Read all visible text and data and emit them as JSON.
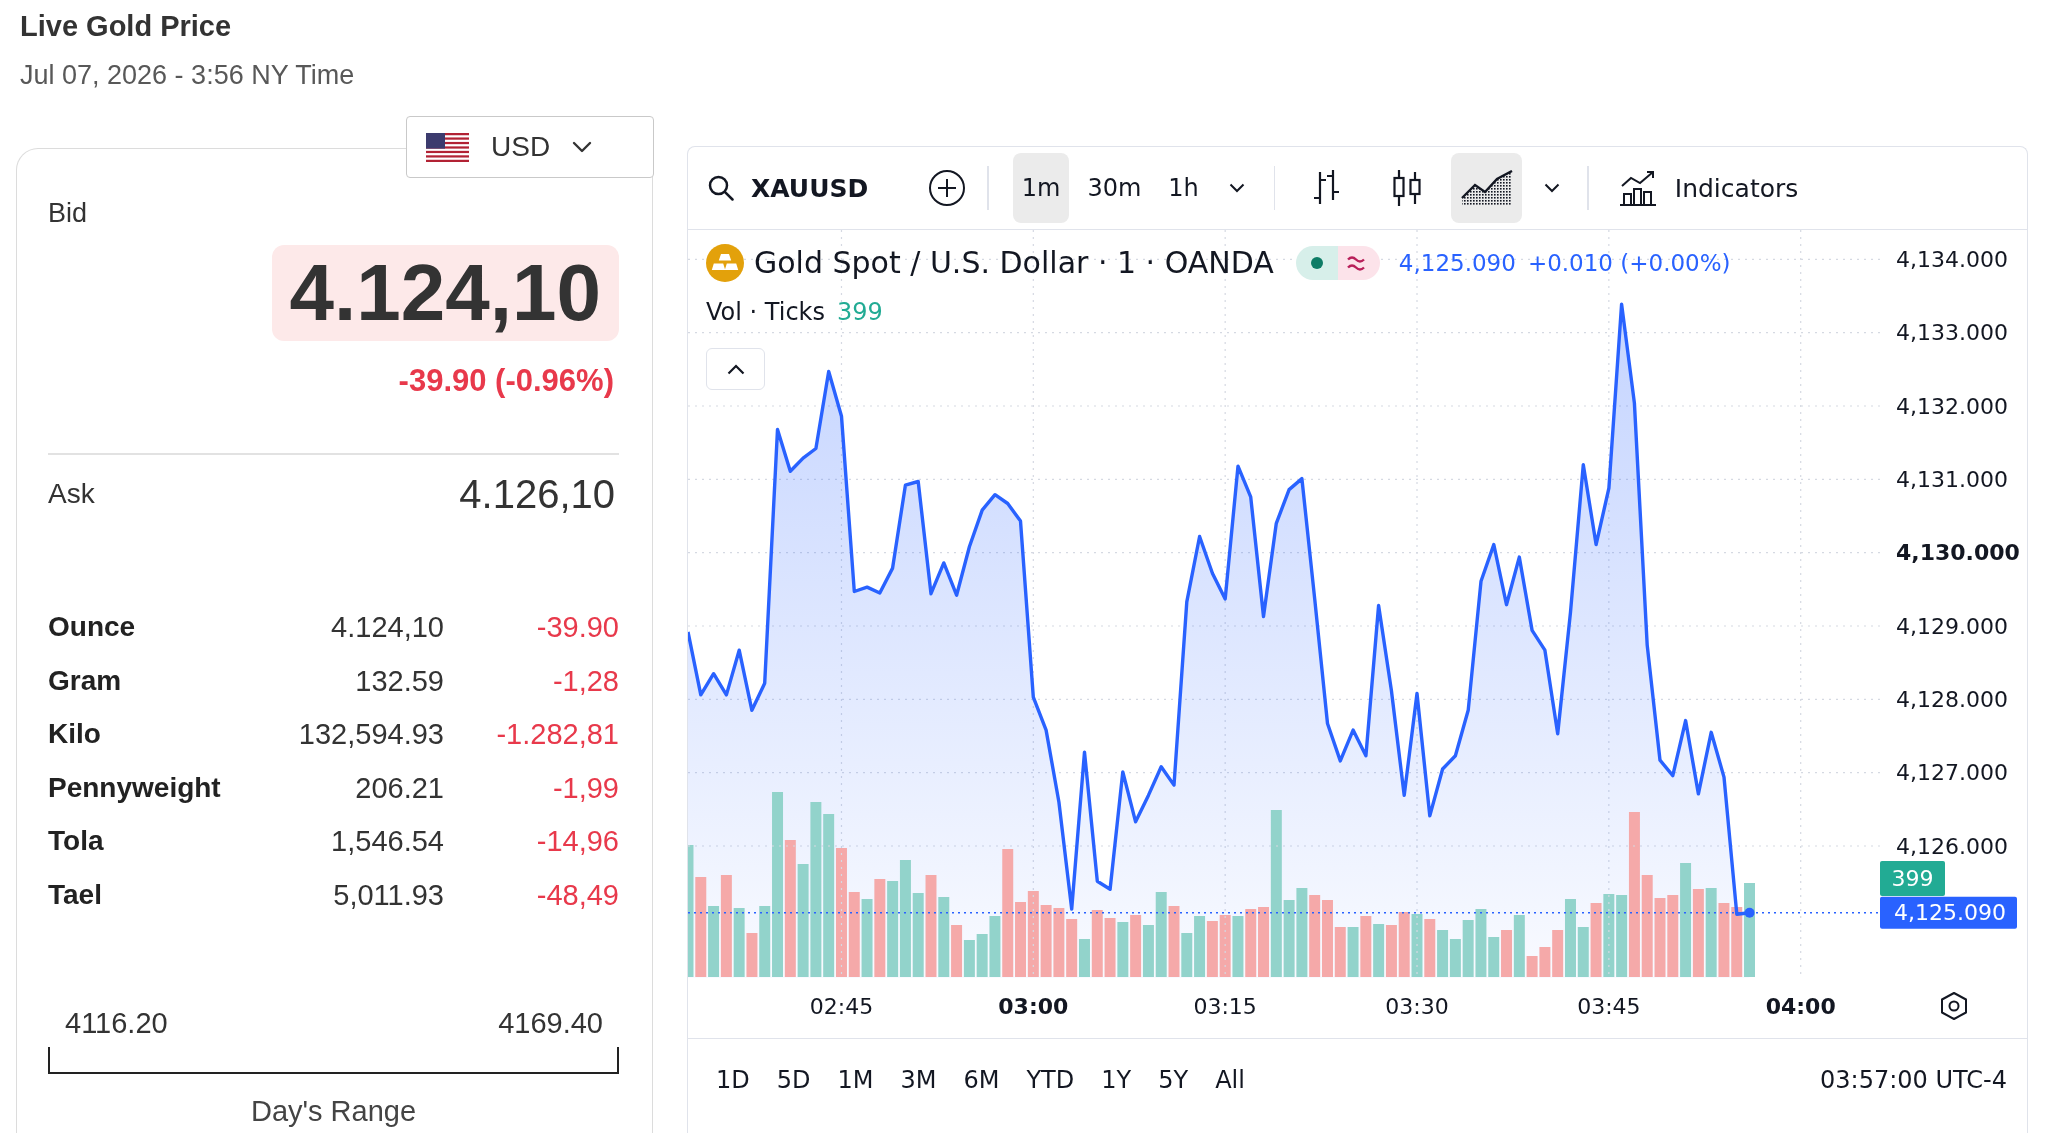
{
  "header": {
    "title": "Live Gold Price",
    "timestamp": "Jul 07, 2026 - 3:56 NY Time"
  },
  "currency": {
    "code": "USD"
  },
  "bid": {
    "label": "Bid",
    "value": "4.124,10",
    "change": "-39.90 (-0.96%)",
    "negative": true
  },
  "ask": {
    "label": "Ask",
    "value": "4.126,10"
  },
  "units": [
    {
      "unit": "Ounce",
      "price": "4.124,10",
      "change": "-39.90",
      "negative": true
    },
    {
      "unit": "Gram",
      "price": "132.59",
      "change": "-1,28",
      "negative": true
    },
    {
      "unit": "Kilo",
      "price": "132,594.93",
      "change": "-1.282,81",
      "negative": true
    },
    {
      "unit": "Pennyweight",
      "price": "206.21",
      "change": "-1,99",
      "negative": true
    },
    {
      "unit": "Tola",
      "price": "1,546.54",
      "change": "-14,96",
      "negative": true
    },
    {
      "unit": "Tael",
      "price": "5,011.93",
      "change": "-48,49",
      "negative": true
    }
  ],
  "days_range": {
    "low": "4116.20",
    "high": "4169.40",
    "label": "Day's Range"
  },
  "chart": {
    "toolbar": {
      "symbol": "XAUUSD",
      "intervals": [
        {
          "label": "1m",
          "selected": true
        },
        {
          "label": "30m",
          "selected": false
        },
        {
          "label": "1h",
          "selected": false
        }
      ],
      "chart_styles": [
        {
          "kind": "bars",
          "selected": false
        },
        {
          "kind": "candles",
          "selected": false
        },
        {
          "kind": "area",
          "selected": true
        }
      ],
      "indicators_label": "Indicators"
    },
    "legend": {
      "title": "Gold Spot / U.S. Dollar · 1 · OANDA",
      "last_price": "4,125.090",
      "change": "+0.010 (+0.00%)",
      "volume_label": "Vol · Ticks",
      "volume_value": "399"
    },
    "volume_tag": "399",
    "chart_data": {
      "type": "area",
      "grid": true,
      "xlim": [
        153,
        246.2
      ],
      "ylim": [
        4124.2,
        4134.4
      ],
      "x": [
        153,
        154,
        155,
        156,
        157,
        158,
        159,
        160,
        161,
        162,
        163,
        164,
        165,
        166,
        167,
        168,
        169,
        170,
        171,
        172,
        173,
        174,
        175,
        176,
        177,
        178,
        179,
        180,
        181,
        182,
        183,
        184,
        185,
        186,
        187,
        188,
        189,
        190,
        191,
        192,
        193,
        194,
        195,
        196,
        197,
        198,
        199,
        200,
        201,
        202,
        203,
        204,
        205,
        206,
        207,
        208,
        209,
        210,
        211,
        212,
        213,
        214,
        215,
        216,
        217,
        218,
        219,
        220,
        221,
        222,
        223,
        224,
        225,
        226,
        227,
        228,
        229,
        230,
        231,
        232,
        233,
        234,
        235,
        236
      ],
      "series": [
        {
          "color": "#2962ff",
          "values": [
            4128.92,
            4128.06,
            4128.35,
            4128.06,
            4128.67,
            4127.85,
            4128.22,
            4131.68,
            4131.11,
            4131.29,
            4131.42,
            4132.47,
            4131.86,
            4129.47,
            4129.53,
            4129.45,
            4129.79,
            4130.92,
            4130.97,
            4129.44,
            4129.86,
            4129.42,
            4130.08,
            4130.58,
            4130.79,
            4130.67,
            4130.43,
            4128.03,
            4127.58,
            4126.6,
            4125.14,
            4127.28,
            4125.52,
            4125.41,
            4127.01,
            4126.33,
            4126.69,
            4127.08,
            4126.83,
            4129.33,
            4130.22,
            4129.72,
            4129.37,
            4131.18,
            4130.76,
            4129.13,
            4130.4,
            4130.86,
            4131.01,
            4129.37,
            4127.67,
            4127.16,
            4127.58,
            4127.23,
            4129.28,
            4128.12,
            4126.69,
            4128.08,
            4126.41,
            4127.05,
            4127.23,
            4127.85,
            4129.61,
            4130.11,
            4129.29,
            4129.94,
            4128.94,
            4128.67,
            4127.53,
            4129.19,
            4131.2,
            4130.11,
            4130.88,
            4133.39,
            4132.04,
            4128.74,
            4127.17,
            4126.96,
            4127.71,
            4126.71,
            4127.55,
            4126.94,
            4125.07,
            4125.09
          ]
        }
      ],
      "ref_lines": [
        {
          "axis": "y",
          "value": 4125.09,
          "label": "4,125.090"
        }
      ],
      "xticks": [
        {
          "value": 165,
          "label": "02:45"
        },
        {
          "value": 180,
          "label": "03:00"
        },
        {
          "value": 195,
          "label": "03:15"
        },
        {
          "value": 210,
          "label": "03:30"
        },
        {
          "value": 225,
          "label": "03:45"
        },
        {
          "value": 240,
          "label": "04:00"
        }
      ],
      "yticks": [
        {
          "value": 4126,
          "label": "4,126.000"
        },
        {
          "value": 4127,
          "label": "4,127.000"
        },
        {
          "value": 4128,
          "label": "4,128.000"
        },
        {
          "value": 4129,
          "label": "4,129.000"
        },
        {
          "value": 4130,
          "label": "4,130.000"
        },
        {
          "value": 4131,
          "label": "4,131.000"
        },
        {
          "value": 4132,
          "label": "4,132.000"
        },
        {
          "value": 4133,
          "label": "4,133.000"
        },
        {
          "value": 4134,
          "label": "4,134.000"
        }
      ]
    },
    "ranges": [
      "1D",
      "5D",
      "1M",
      "3M",
      "6M",
      "YTD",
      "1Y",
      "5Y",
      "All"
    ],
    "clock": "03:57:00 UTC-4"
  }
}
